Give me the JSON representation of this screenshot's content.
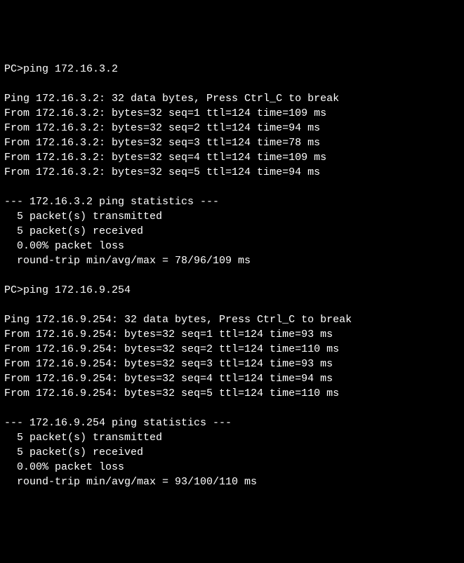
{
  "terminal": {
    "prompt": "PC>",
    "sessions": [
      {
        "command": "ping 172.16.3.2",
        "header": "Ping 172.16.3.2: 32 data bytes, Press Ctrl_C to break",
        "replies": [
          "From 172.16.3.2: bytes=32 seq=1 ttl=124 time=109 ms",
          "From 172.16.3.2: bytes=32 seq=2 ttl=124 time=94 ms",
          "From 172.16.3.2: bytes=32 seq=3 ttl=124 time=78 ms",
          "From 172.16.3.2: bytes=32 seq=4 ttl=124 time=109 ms",
          "From 172.16.3.2: bytes=32 seq=5 ttl=124 time=94 ms"
        ],
        "stats_header": "--- 172.16.3.2 ping statistics ---",
        "stats": [
          "  5 packet(s) transmitted",
          "  5 packet(s) received",
          "  0.00% packet loss",
          "  round-trip min/avg/max = 78/96/109 ms"
        ]
      },
      {
        "command": "ping 172.16.9.254",
        "header": "Ping 172.16.9.254: 32 data bytes, Press Ctrl_C to break",
        "replies": [
          "From 172.16.9.254: bytes=32 seq=1 ttl=124 time=93 ms",
          "From 172.16.9.254: bytes=32 seq=2 ttl=124 time=110 ms",
          "From 172.16.9.254: bytes=32 seq=3 ttl=124 time=93 ms",
          "From 172.16.9.254: bytes=32 seq=4 ttl=124 time=94 ms",
          "From 172.16.9.254: bytes=32 seq=5 ttl=124 time=110 ms"
        ],
        "stats_header": "--- 172.16.9.254 ping statistics ---",
        "stats": [
          "  5 packet(s) transmitted",
          "  5 packet(s) received",
          "  0.00% packet loss",
          "  round-trip min/avg/max = 93/100/110 ms"
        ]
      }
    ]
  }
}
